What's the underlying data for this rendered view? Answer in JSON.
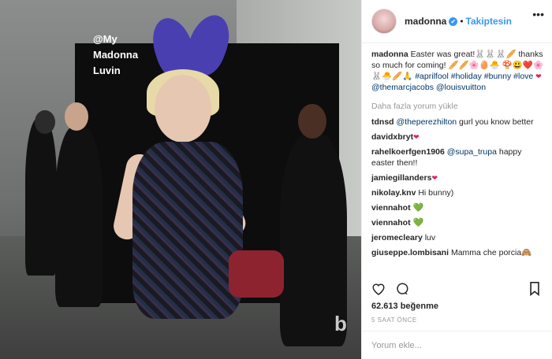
{
  "photo": {
    "watermark": "@My\nMadonna\nLuvin",
    "overlay_logo": "b"
  },
  "header": {
    "username": "madonna",
    "verified": "✔",
    "separator": "•",
    "follow_label": "Takiptesin"
  },
  "caption": {
    "username": "madonna",
    "text": "Easter was great!🐰🐰🐰🥖 thanks so much for coming! 🥖🥖🌸🥚🐣 🍄😃❤️🌸🐰🐣🥖🙏 ",
    "tags": "#aprilfool #holiday #bunny #love",
    "heart": "❤",
    "mentions": "@themarcjacobs @louisvuitton"
  },
  "more_comments": "Daha fazla yorum yükle",
  "comments": [
    {
      "user": "tdnsd",
      "mention": "@theperezhilton",
      "text": " gurl you know better"
    },
    {
      "user": "davidxbryt",
      "mention": "",
      "text": "❤"
    },
    {
      "user": "rahelkoerfgen1906",
      "mention": "@supa_trupa",
      "text": " happy easter then!!"
    },
    {
      "user": "jamiegillanders",
      "mention": "",
      "text": "❤"
    },
    {
      "user": "nikolay.knv",
      "mention": "",
      "text": " Hi bunny)"
    },
    {
      "user": "viennahot",
      "mention": "",
      "text": "💚"
    },
    {
      "user": "viennahot",
      "mention": "",
      "text": "💚"
    },
    {
      "user": "jeromecleary",
      "mention": "",
      "text": " luv"
    },
    {
      "user": "giuseppe.lombisani",
      "mention": "",
      "text": " Mamma che porcia🙈"
    }
  ],
  "actions": {
    "like_icon": "heart-outline-icon",
    "comment_icon": "speech-bubble-icon",
    "save_icon": "bookmark-icon"
  },
  "likes": "62.613 beğenme",
  "timestamp": "5 SAAT ÖNCE",
  "add_comment_placeholder": "Yorum ekle...",
  "more_options": "•••"
}
